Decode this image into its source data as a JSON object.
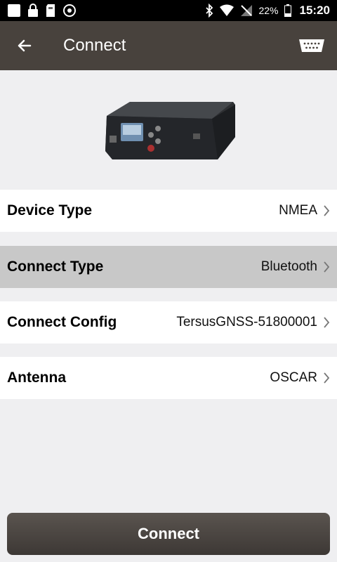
{
  "status_bar": {
    "battery": "22%",
    "time": "15:20"
  },
  "app_bar": {
    "title": "Connect"
  },
  "settings": [
    {
      "label": "Device Type",
      "value": "NMEA"
    },
    {
      "label": "Connect Type",
      "value": "Bluetooth"
    },
    {
      "label": "Connect Config",
      "value": "TersusGNSS-51800001"
    },
    {
      "label": "Antenna",
      "value": "OSCAR"
    }
  ],
  "connect_button": {
    "label": "Connect"
  },
  "colors": {
    "app_bar": "#48423d",
    "selected_row": "#c8c8c8",
    "background": "#efeff1"
  }
}
